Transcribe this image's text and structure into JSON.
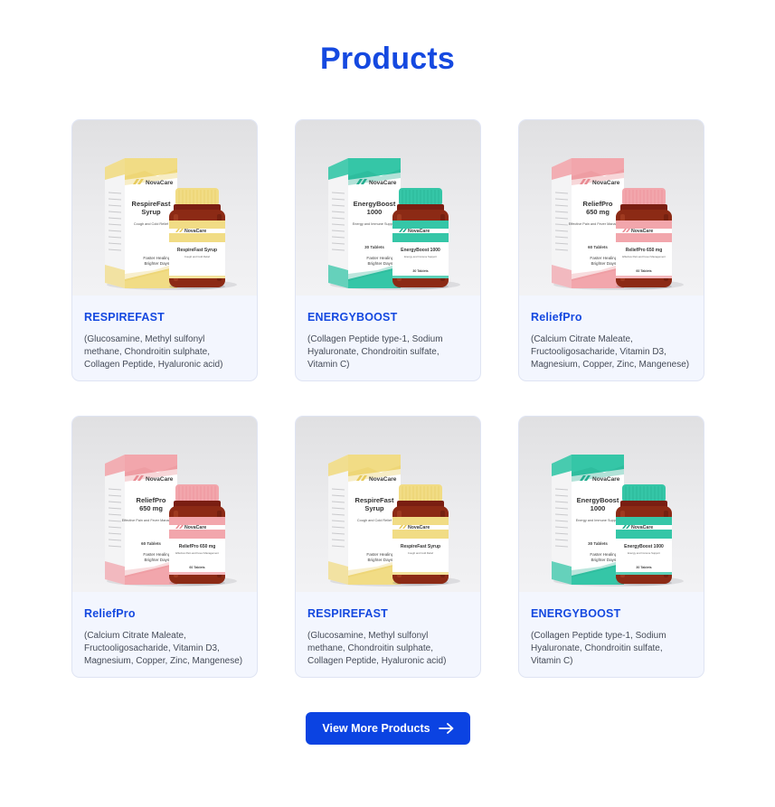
{
  "page": {
    "title": "Products"
  },
  "products": [
    {
      "name": "RESPIREFAST",
      "description": "(Glucosamine, Methyl sulfonyl methane, Chondroitin sulphate, Collagen Peptide, Hyaluronic acid)",
      "image": {
        "brand": "NovaCare",
        "box_title_1": "RespireFast",
        "box_title_2": "Syrup",
        "box_subtitle": "Cough and Cold Relief",
        "box_count": "",
        "box_tagline_1": "Faster Healing,",
        "box_tagline_2": "Brighter Days!",
        "bottle_title": "RespireFast Syrup",
        "bottle_subtitle": "Cough and Cold Relief",
        "bottle_count": "",
        "accent_color": "#f1dc85",
        "accent_dark": "#e7cb5d"
      }
    },
    {
      "name": "ENERGYBOOST",
      "description": "(Collagen Peptide type-1, Sodium Hyaluronate, Chondroitin sulfate, Vitamin C)",
      "image": {
        "brand": "NovaCare",
        "box_title_1": "EnergyBoost",
        "box_title_2": "1000",
        "box_subtitle": "Energy and Immune Support",
        "box_count": "30 Tablets",
        "box_tagline_1": "Faster Healing,",
        "box_tagline_2": "Brighter Days!",
        "bottle_title": "EnergyBoost 1000",
        "bottle_subtitle": "Energy and Immune Support",
        "bottle_count": "30 Tablets",
        "accent_color": "#35c6a7",
        "accent_dark": "#22ad8f"
      }
    },
    {
      "name": "ReliefPro",
      "description": "(Calcium Citrate Maleate, Fructooligosacharide, Vitamin D3, Magnesium, Copper, Zinc, Mangenese)",
      "image": {
        "brand": "NovaCare",
        "box_title_1": "ReliefPro",
        "box_title_2": "650 mg",
        "box_subtitle": "Effective Pain and Fever Management",
        "box_count": "60 Tablets",
        "box_tagline_1": "Faster Healing,",
        "box_tagline_2": "Brighter Days!",
        "bottle_title": "ReliefPro 650 mg",
        "bottle_subtitle": "Effective Pain and Fever Management",
        "bottle_count": "60 Tablets",
        "accent_color": "#f2a6ac",
        "accent_dark": "#e98b93"
      }
    },
    {
      "name": "ReliefPro",
      "description": "(Calcium Citrate Maleate, Fructooligosacharide, Vitamin D3, Magnesium, Copper, Zinc, Mangenese)",
      "image": {
        "brand": "NovaCare",
        "box_title_1": "ReliefPro",
        "box_title_2": "650 mg",
        "box_subtitle": "Effective Pain and Fever Management",
        "box_count": "60 Tablets",
        "box_tagline_1": "Faster Healing,",
        "box_tagline_2": "Brighter Days!",
        "bottle_title": "ReliefPro 650 mg",
        "bottle_subtitle": "Effective Pain and Fever Management",
        "bottle_count": "60 Tablets",
        "accent_color": "#f2a6ac",
        "accent_dark": "#e98b93"
      }
    },
    {
      "name": "RESPIREFAST",
      "description": "(Glucosamine, Methyl sulfonyl methane, Chondroitin sulphate, Collagen Peptide, Hyaluronic acid)",
      "image": {
        "brand": "NovaCare",
        "box_title_1": "RespireFast",
        "box_title_2": "Syrup",
        "box_subtitle": "Cough and Cold Relief",
        "box_count": "",
        "box_tagline_1": "Faster Healing,",
        "box_tagline_2": "Brighter Days!",
        "bottle_title": "RespireFast Syrup",
        "bottle_subtitle": "Cough and Cold Relief",
        "bottle_count": "",
        "accent_color": "#f1dc85",
        "accent_dark": "#e7cb5d"
      }
    },
    {
      "name": "ENERGYBOOST",
      "description": "(Collagen Peptide type-1, Sodium Hyaluronate, Chondroitin sulfate, Vitamin C)",
      "image": {
        "brand": "NovaCare",
        "box_title_1": "EnergyBoost",
        "box_title_2": "1000",
        "box_subtitle": "Energy and Immune Support",
        "box_count": "30 Tablets",
        "box_tagline_1": "Faster Healing,",
        "box_tagline_2": "Brighter Days!",
        "bottle_title": "EnergyBoost 1000",
        "bottle_subtitle": "Energy and Immune Support",
        "bottle_count": "30 Tablets",
        "accent_color": "#35c6a7",
        "accent_dark": "#22ad8f"
      }
    }
  ],
  "cta": {
    "label": "View More Products",
    "icon": "arrow-right-icon"
  },
  "colors": {
    "primary": "#1549e0",
    "button": "#0b43e2",
    "card_bg": "#f3f6fe",
    "card_border": "#dfe4f3"
  }
}
